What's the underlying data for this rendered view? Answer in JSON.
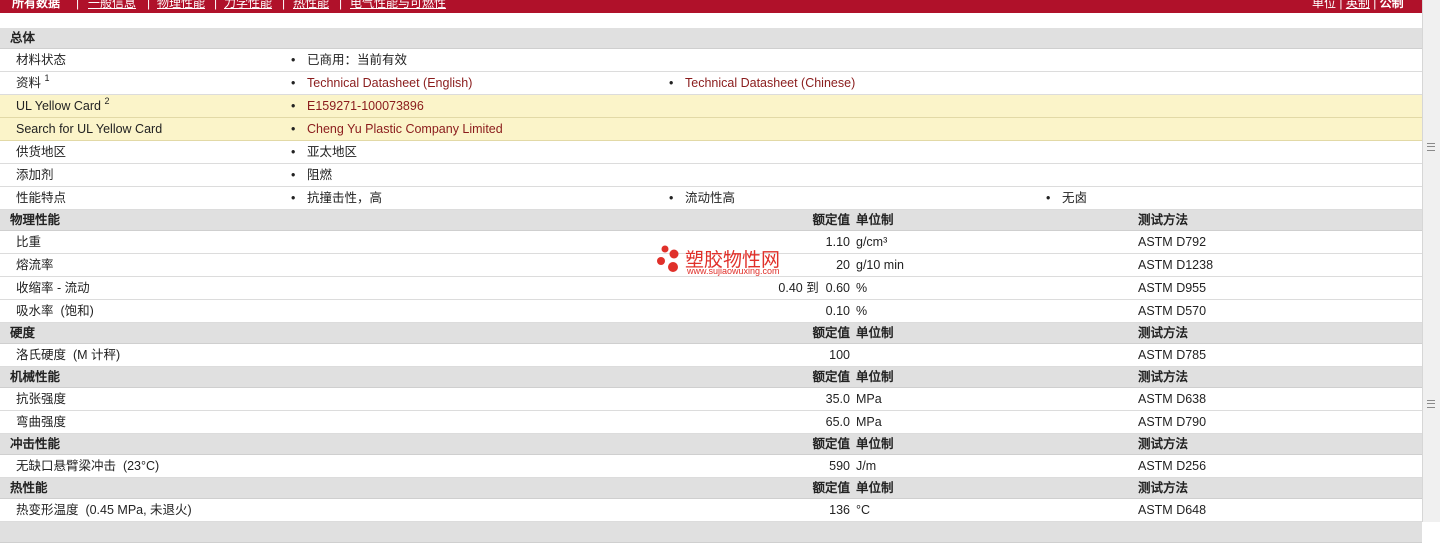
{
  "topbar": {
    "all_data": "所有数据",
    "tabs": [
      "一般信息",
      "物理性能",
      "力学性能",
      "热性能",
      "电气性能与可燃性"
    ],
    "unit_label": "单位",
    "unit_imperial": "英制",
    "unit_metric": "公制"
  },
  "general": {
    "section_title": "总体",
    "rows": [
      {
        "label": "材料状态",
        "values": [
          "已商用：当前有效"
        ]
      },
      {
        "label": "资料",
        "sup": "1",
        "values": [
          "Technical Datasheet (English)",
          "Technical Datasheet (Chinese)"
        ]
      },
      {
        "label": "UL Yellow Card",
        "sup": "2",
        "values": [
          "E159271-100073896"
        ]
      },
      {
        "label": "Search for UL Yellow Card",
        "values": [
          "Cheng Yu Plastic Company Limited"
        ]
      },
      {
        "label": "供货地区",
        "values": [
          "亚太地区"
        ]
      },
      {
        "label": "添加剂",
        "values": [
          "阻燃"
        ]
      },
      {
        "label": "性能特点",
        "values": [
          "抗撞击性，高",
          "流动性高",
          "无卤"
        ]
      }
    ]
  },
  "headers": {
    "nominal": "额定值",
    "unit": "单位制",
    "method": "测试方法"
  },
  "sections": [
    {
      "title": "物理性能",
      "rows": [
        {
          "label": "比重",
          "value": "1.10",
          "unit": "g/cm³",
          "method": "ASTM D792"
        },
        {
          "label": "熔流率",
          "value": "20",
          "unit": "g/10 min",
          "method": "ASTM D1238"
        },
        {
          "label": "收缩率  - 流动",
          "value": "0.40 到  0.60",
          "unit": "%",
          "method": "ASTM D955"
        },
        {
          "label": "吸水率  (饱和)",
          "value": "0.10",
          "unit": "%",
          "method": "ASTM D570"
        }
      ]
    },
    {
      "title": "硬度",
      "rows": [
        {
          "label": "洛氏硬度  (M 计秤)",
          "value": "100",
          "unit": "",
          "method": "ASTM D785"
        }
      ]
    },
    {
      "title": "机械性能",
      "rows": [
        {
          "label": "抗张强度",
          "value": "35.0",
          "unit": "MPa",
          "method": "ASTM D638"
        },
        {
          "label": "弯曲强度",
          "value": "65.0",
          "unit": "MPa",
          "method": "ASTM D790"
        }
      ]
    },
    {
      "title": "冲击性能",
      "rows": [
        {
          "label": "无缺口悬臂梁冲击  (23°C)",
          "value": "590",
          "unit": "J/m",
          "method": "ASTM D256"
        }
      ]
    },
    {
      "title": "热性能",
      "rows": [
        {
          "label": "热变形温度  (0.45 MPa, 未退火)",
          "value": "136",
          "unit": "°C",
          "method": "ASTM D648"
        }
      ]
    }
  ],
  "watermark": {
    "name": "塑胶物性网",
    "url": "www.sujiaowuxing.com"
  },
  "colors": {
    "topbar": "#b0112a",
    "section": "#e0e0e0",
    "highlight": "#fbf4c9",
    "link": "#8a1c1c",
    "watermark": "#e0302a"
  }
}
